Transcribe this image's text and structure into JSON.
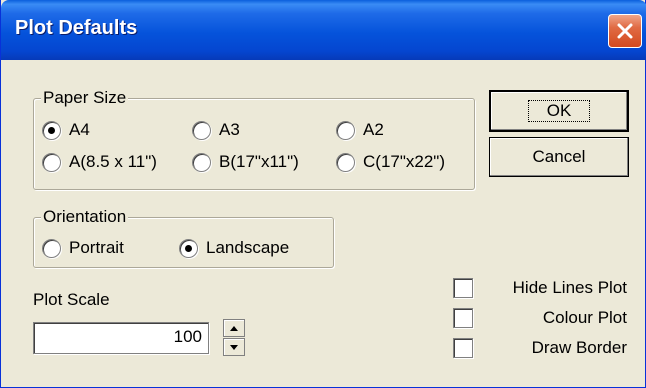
{
  "window": {
    "title": "Plot Defaults",
    "close_icon": "close-icon"
  },
  "paper_size": {
    "legend": "Paper Size",
    "options": [
      "A4",
      "A3",
      "A2",
      "A(8.5 x 11\")",
      "B(17\"x11\")",
      "C(17\"x22\")"
    ],
    "selected": "A4"
  },
  "orientation": {
    "legend": "Orientation",
    "options": [
      "Portrait",
      "Landscape"
    ],
    "selected": "Landscape"
  },
  "plot_scale": {
    "label": "Plot Scale",
    "value": "100"
  },
  "buttons": {
    "ok": "OK",
    "cancel": "Cancel"
  },
  "checkboxes": [
    {
      "label": "Hide Lines Plot",
      "checked": false
    },
    {
      "label": "Colour Plot",
      "checked": false
    },
    {
      "label": "Draw Border",
      "checked": false
    }
  ],
  "colors": {
    "titlebar": "#0553db",
    "face": "#ece9d8",
    "close": "#d44a1f"
  }
}
